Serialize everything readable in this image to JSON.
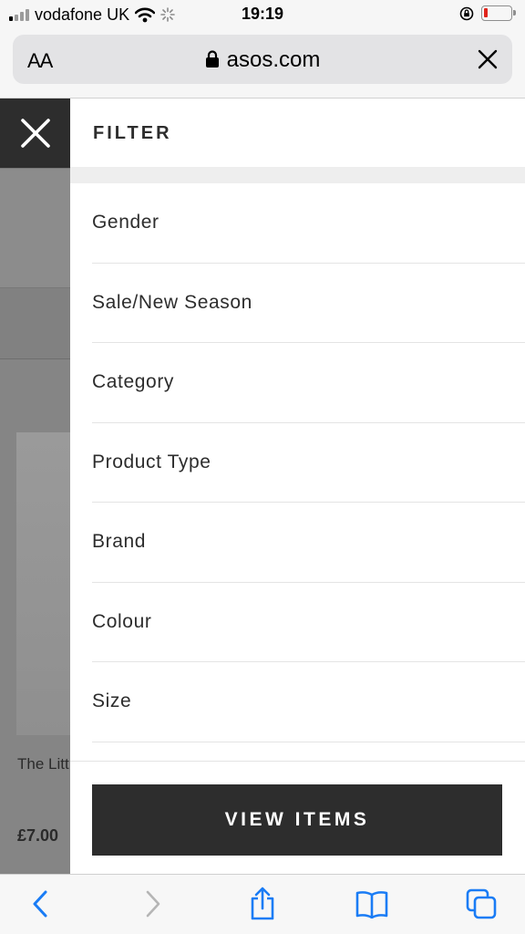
{
  "status_bar": {
    "carrier": "vodafone UK",
    "time": "19:19"
  },
  "browser": {
    "text_size_label": "AA",
    "url": "asos.com"
  },
  "background_page": {
    "product_title": "The Litt",
    "product_price": "£7.00"
  },
  "filter": {
    "title": "FILTER",
    "items": [
      {
        "label": "Gender"
      },
      {
        "label": "Sale/New Season"
      },
      {
        "label": "Category"
      },
      {
        "label": "Product Type"
      },
      {
        "label": "Brand"
      },
      {
        "label": "Colour"
      },
      {
        "label": "Size"
      }
    ],
    "view_items_label": "VIEW ITEMS"
  },
  "toolbar": {
    "icons": [
      "back-icon",
      "forward-icon",
      "share-icon",
      "bookmarks-icon",
      "tabs-icon"
    ]
  },
  "colors": {
    "ios_blue": "#1a7cf5",
    "dark": "#2d2d2d",
    "battery_low": "#e0241b"
  }
}
